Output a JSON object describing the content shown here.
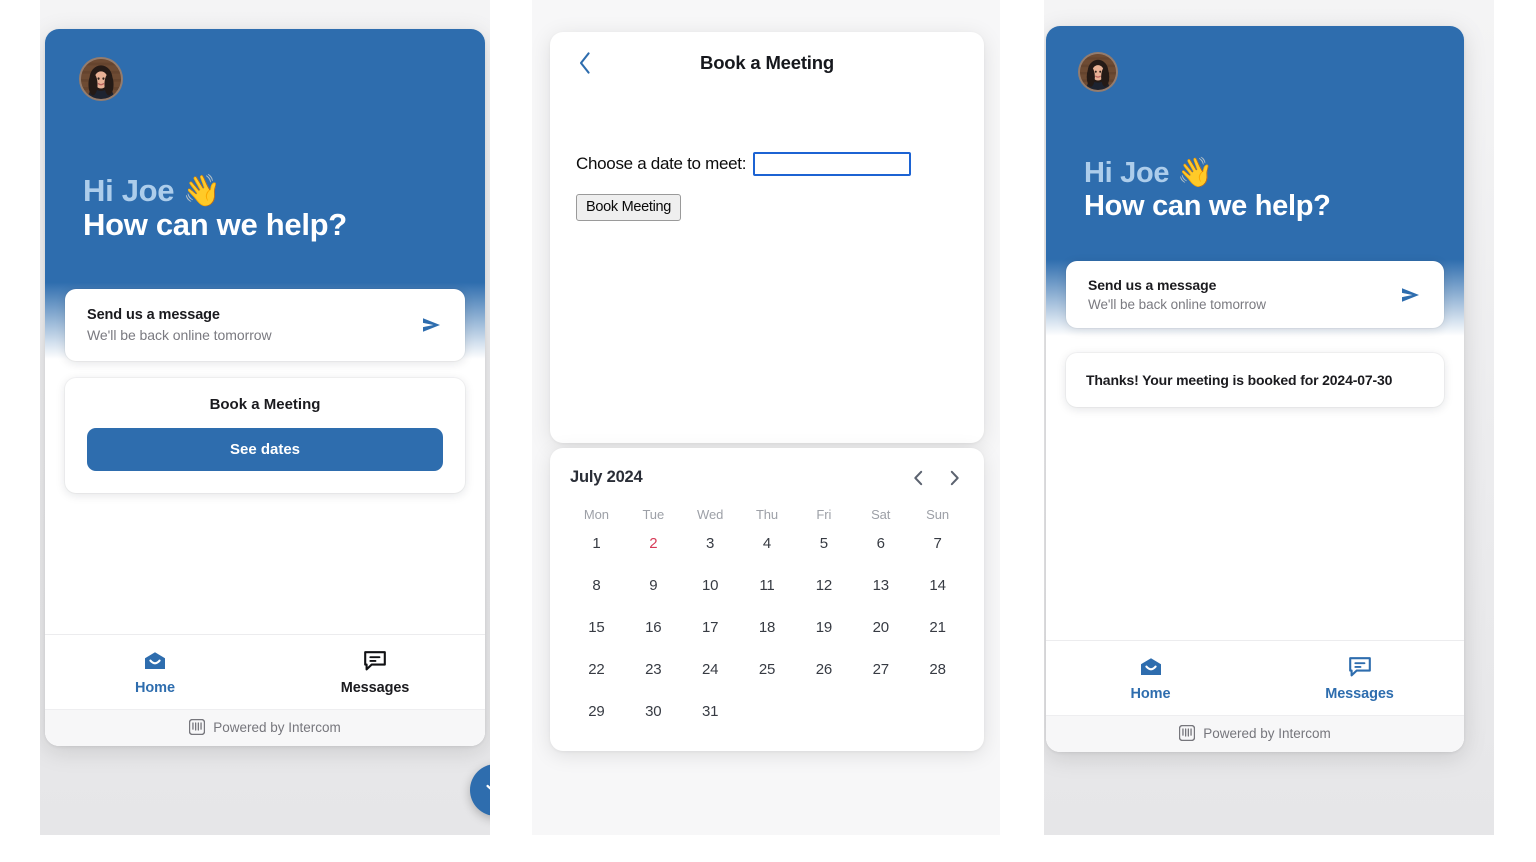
{
  "brand": {
    "blue": "#2e6dae",
    "light_blue_text": "#adcdeb",
    "today_red": "#d73a57"
  },
  "panel1": {
    "hero": {
      "avatar_alt": "support-agent-avatar",
      "greeting_line1": "Hi Joe 👋",
      "greeting_line2": "How can we help?"
    },
    "message_card": {
      "title": "Send us a message",
      "subtitle": "We'll be back online tomorrow",
      "icon": "send-icon"
    },
    "book_card": {
      "title": "Book a Meeting",
      "button_label": "See dates"
    },
    "nav": {
      "items": [
        {
          "label": "Home",
          "icon": "home-icon",
          "active": true
        },
        {
          "label": "Messages",
          "icon": "messages-icon",
          "active": false
        }
      ],
      "powered_by": "Powered by Intercom",
      "powered_icon": "intercom-logo-icon"
    },
    "launcher_icon": "chevron-down-icon"
  },
  "panel2": {
    "header": {
      "back_icon": "chevron-left-icon",
      "title": "Book a Meeting"
    },
    "form": {
      "label": "Choose a date to meet:",
      "input_value": "",
      "input_placeholder": "",
      "submit_label": "Book Meeting"
    },
    "calendar": {
      "month_label": "July 2024",
      "prev_icon": "chevron-left-icon",
      "next_icon": "chevron-right-icon",
      "weekdays": [
        "Mon",
        "Tue",
        "Wed",
        "Thu",
        "Fri",
        "Sat",
        "Sun"
      ],
      "today": 2,
      "leading_blanks": 0,
      "days": [
        1,
        2,
        3,
        4,
        5,
        6,
        7,
        8,
        9,
        10,
        11,
        12,
        13,
        14,
        15,
        16,
        17,
        18,
        19,
        20,
        21,
        22,
        23,
        24,
        25,
        26,
        27,
        28,
        29,
        30,
        31
      ]
    },
    "launcher_icon": "chevron-down-icon"
  },
  "panel3": {
    "hero": {
      "avatar_alt": "support-agent-avatar",
      "greeting_line1": "Hi Joe 👋",
      "greeting_line2": "How can we help?"
    },
    "message_card": {
      "title": "Send us a message",
      "subtitle": "We'll be back online tomorrow",
      "icon": "send-icon"
    },
    "confirmation": {
      "text": "Thanks! Your meeting is booked for 2024-07-30"
    },
    "nav": {
      "items": [
        {
          "label": "Home",
          "icon": "home-icon",
          "active": true
        },
        {
          "label": "Messages",
          "icon": "messages-icon",
          "active": true
        }
      ],
      "powered_by": "Powered by Intercom",
      "powered_icon": "intercom-logo-icon"
    },
    "launcher_icon": "chevron-down-icon"
  }
}
